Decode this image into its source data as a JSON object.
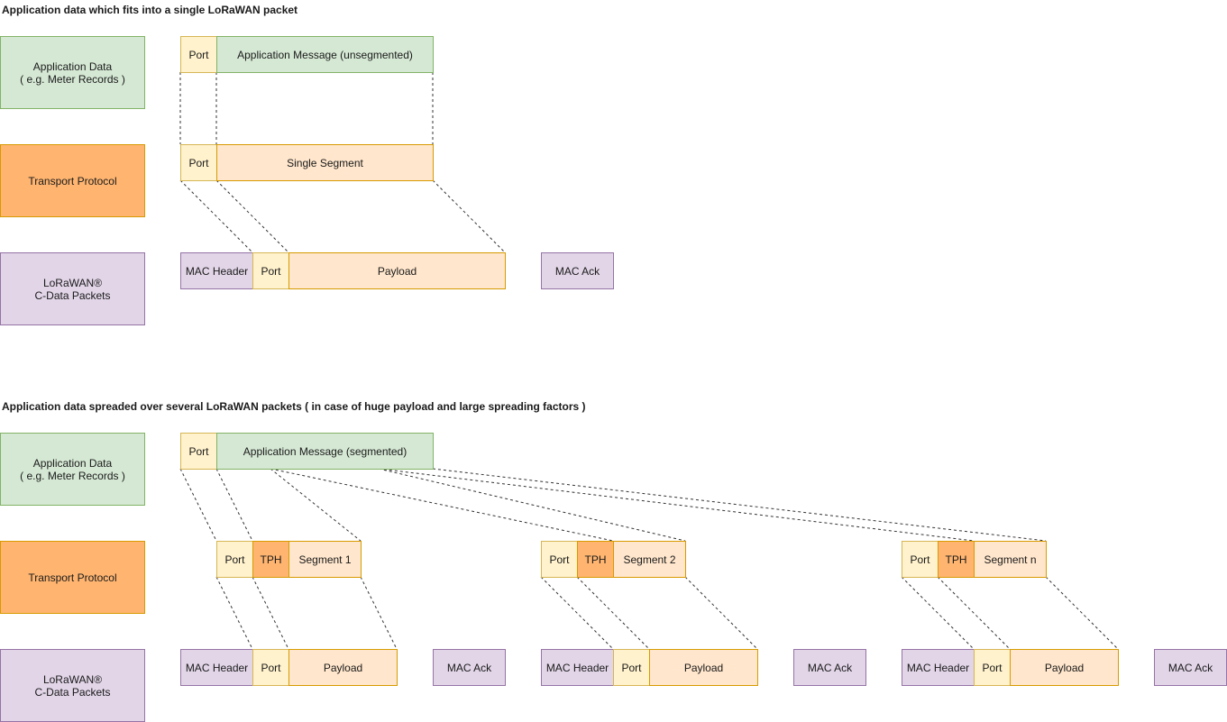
{
  "section1": {
    "title": "Application data which fits into a single LoRaWAN packet",
    "layers": {
      "application": "Application Data\n( e.g. Meter Records )",
      "transport": "Transport Protocol",
      "lorawan": "LoRaWAN®\nC-Data Packets"
    },
    "app_row": {
      "port": "Port",
      "message": "Application Message (unsegmented)"
    },
    "transport_row": {
      "port": "Port",
      "segment": "Single Segment"
    },
    "packet_row": {
      "mac_header": "MAC Header",
      "port": "Port",
      "payload": "Payload",
      "mac_ack": "MAC Ack"
    }
  },
  "section2": {
    "title": "Application data spreaded over several LoRaWAN packets ( in case of huge payload and large spreading factors )",
    "layers": {
      "application": "Application Data\n( e.g. Meter Records )",
      "transport": "Transport Protocol",
      "lorawan": "LoRaWAN®\nC-Data Packets"
    },
    "app_row": {
      "port": "Port",
      "message": "Application Message (segmented)"
    },
    "segments": [
      {
        "port": "Port",
        "tph": "TPH",
        "label": "Segment 1"
      },
      {
        "port": "Port",
        "tph": "TPH",
        "label": "Segment 2"
      },
      {
        "port": "Port",
        "tph": "TPH",
        "label": "Segment n"
      }
    ],
    "packets": [
      {
        "mac_header": "MAC Header",
        "port": "Port",
        "payload": "Payload",
        "mac_ack": "MAC Ack"
      },
      {
        "mac_header": "MAC Header",
        "port": "Port",
        "payload": "Payload",
        "mac_ack": "MAC Ack"
      },
      {
        "mac_header": "MAC Header",
        "port": "Port",
        "payload": "Payload",
        "mac_ack": "MAC Ack"
      }
    ]
  },
  "colors": {
    "application": "#d5e8d4",
    "port": "#fff2cc",
    "segment": "#ffe6cc",
    "transport_header": "#ffb570",
    "lorawan": "#e1d5e7"
  }
}
